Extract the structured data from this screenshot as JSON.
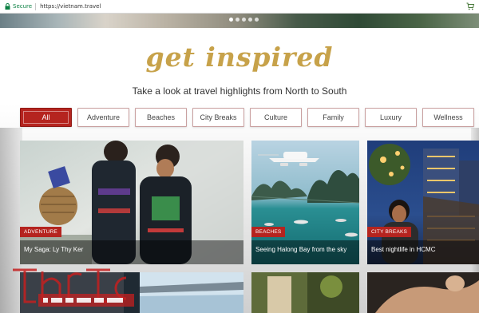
{
  "browser": {
    "secure_label": "Secure",
    "url": "https://vietnam.travel",
    "icons": [
      "lock-icon",
      "cart-icon"
    ]
  },
  "hero": {
    "slide_count": 5,
    "active_slide": 1
  },
  "intro": {
    "title": "get inspired",
    "subtitle": "Take a look at travel highlights from North to South"
  },
  "filters": {
    "items": [
      "All",
      "Adventure",
      "Beaches",
      "City Breaks",
      "Culture",
      "Family",
      "Luxury",
      "Wellness"
    ],
    "active": "All"
  },
  "cards": [
    {
      "category": "ADVENTURE",
      "title": "My Saga: Ly Thy Ker"
    },
    {
      "category": "BEACHES",
      "title": "Seeing Halong Bay from the sky"
    },
    {
      "category": "CITY BREAKS",
      "title": "Best nightlife in HCMC"
    }
  ],
  "colors": {
    "accent": "#b5241f",
    "heading_gold": "#c7a24a",
    "tab_border": "#c9a0a0"
  }
}
